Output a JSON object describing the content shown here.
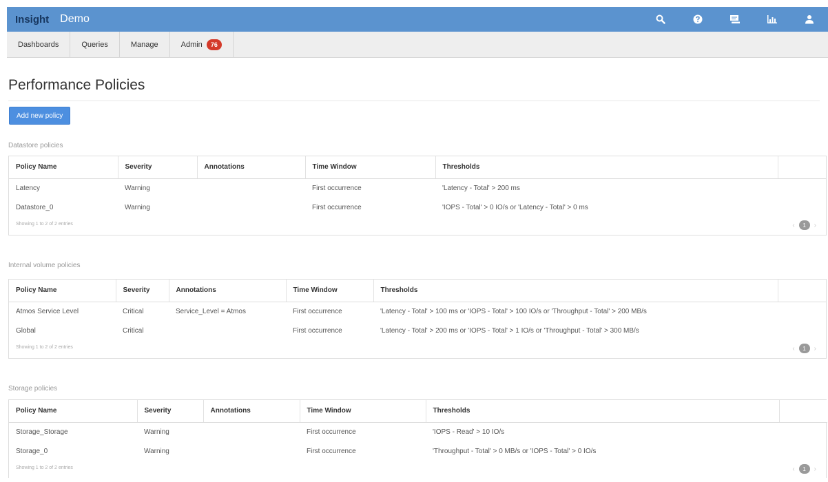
{
  "header": {
    "brand": "Insight",
    "product": "Demo",
    "icons": [
      "search-icon",
      "help-icon",
      "chat-icon",
      "chart-icon",
      "user-icon"
    ]
  },
  "nav": {
    "items": [
      {
        "label": "Dashboards"
      },
      {
        "label": "Queries"
      },
      {
        "label": "Manage"
      },
      {
        "label": "Admin",
        "badge": "76"
      }
    ]
  },
  "page": {
    "title": "Performance Policies",
    "add_button": "Add new policy"
  },
  "columns": [
    "Policy Name",
    "Severity",
    "Annotations",
    "Time Window",
    "Thresholds"
  ],
  "sections": [
    {
      "label": "Datastore policies",
      "rows": [
        [
          "Latency",
          "Warning",
          "",
          "First occurrence",
          "'Latency - Total' > 200 ms"
        ],
        [
          "Datastore_0",
          "Warning",
          "",
          "First occurrence",
          "'IOPS - Total' > 0 IO/s or 'Latency - Total' > 0 ms"
        ]
      ],
      "showing": "Showing 1 to 2 of 2 entries",
      "page": "1"
    },
    {
      "label": "Internal volume policies",
      "rows": [
        [
          "Atmos Service Level",
          "Critical",
          "Service_Level = Atmos",
          "First occurrence",
          "'Latency - Total' > 100 ms or 'IOPS - Total' > 100 IO/s or 'Throughput - Total' > 200 MB/s"
        ],
        [
          "Global",
          "Critical",
          "",
          "First occurrence",
          "'Latency - Total' > 200 ms or 'IOPS - Total' > 1 IO/s or 'Throughput - Total' > 300 MB/s"
        ]
      ],
      "showing": "Showing 1 to 2 of 2 entries",
      "page": "1"
    },
    {
      "label": "Storage policies",
      "rows": [
        [
          "Storage_Storage",
          "Warning",
          "",
          "First occurrence",
          "'IOPS - Read' > 10 IO/s"
        ],
        [
          "Storage_0",
          "Warning",
          "",
          "First occurrence",
          "'Throughput - Total' > 0 MB/s or 'IOPS - Total' > 0 IO/s"
        ]
      ],
      "showing": "Showing 1 to 2 of 2 entries",
      "page": "1"
    }
  ],
  "pager": {
    "prev": "‹",
    "next": "›"
  }
}
